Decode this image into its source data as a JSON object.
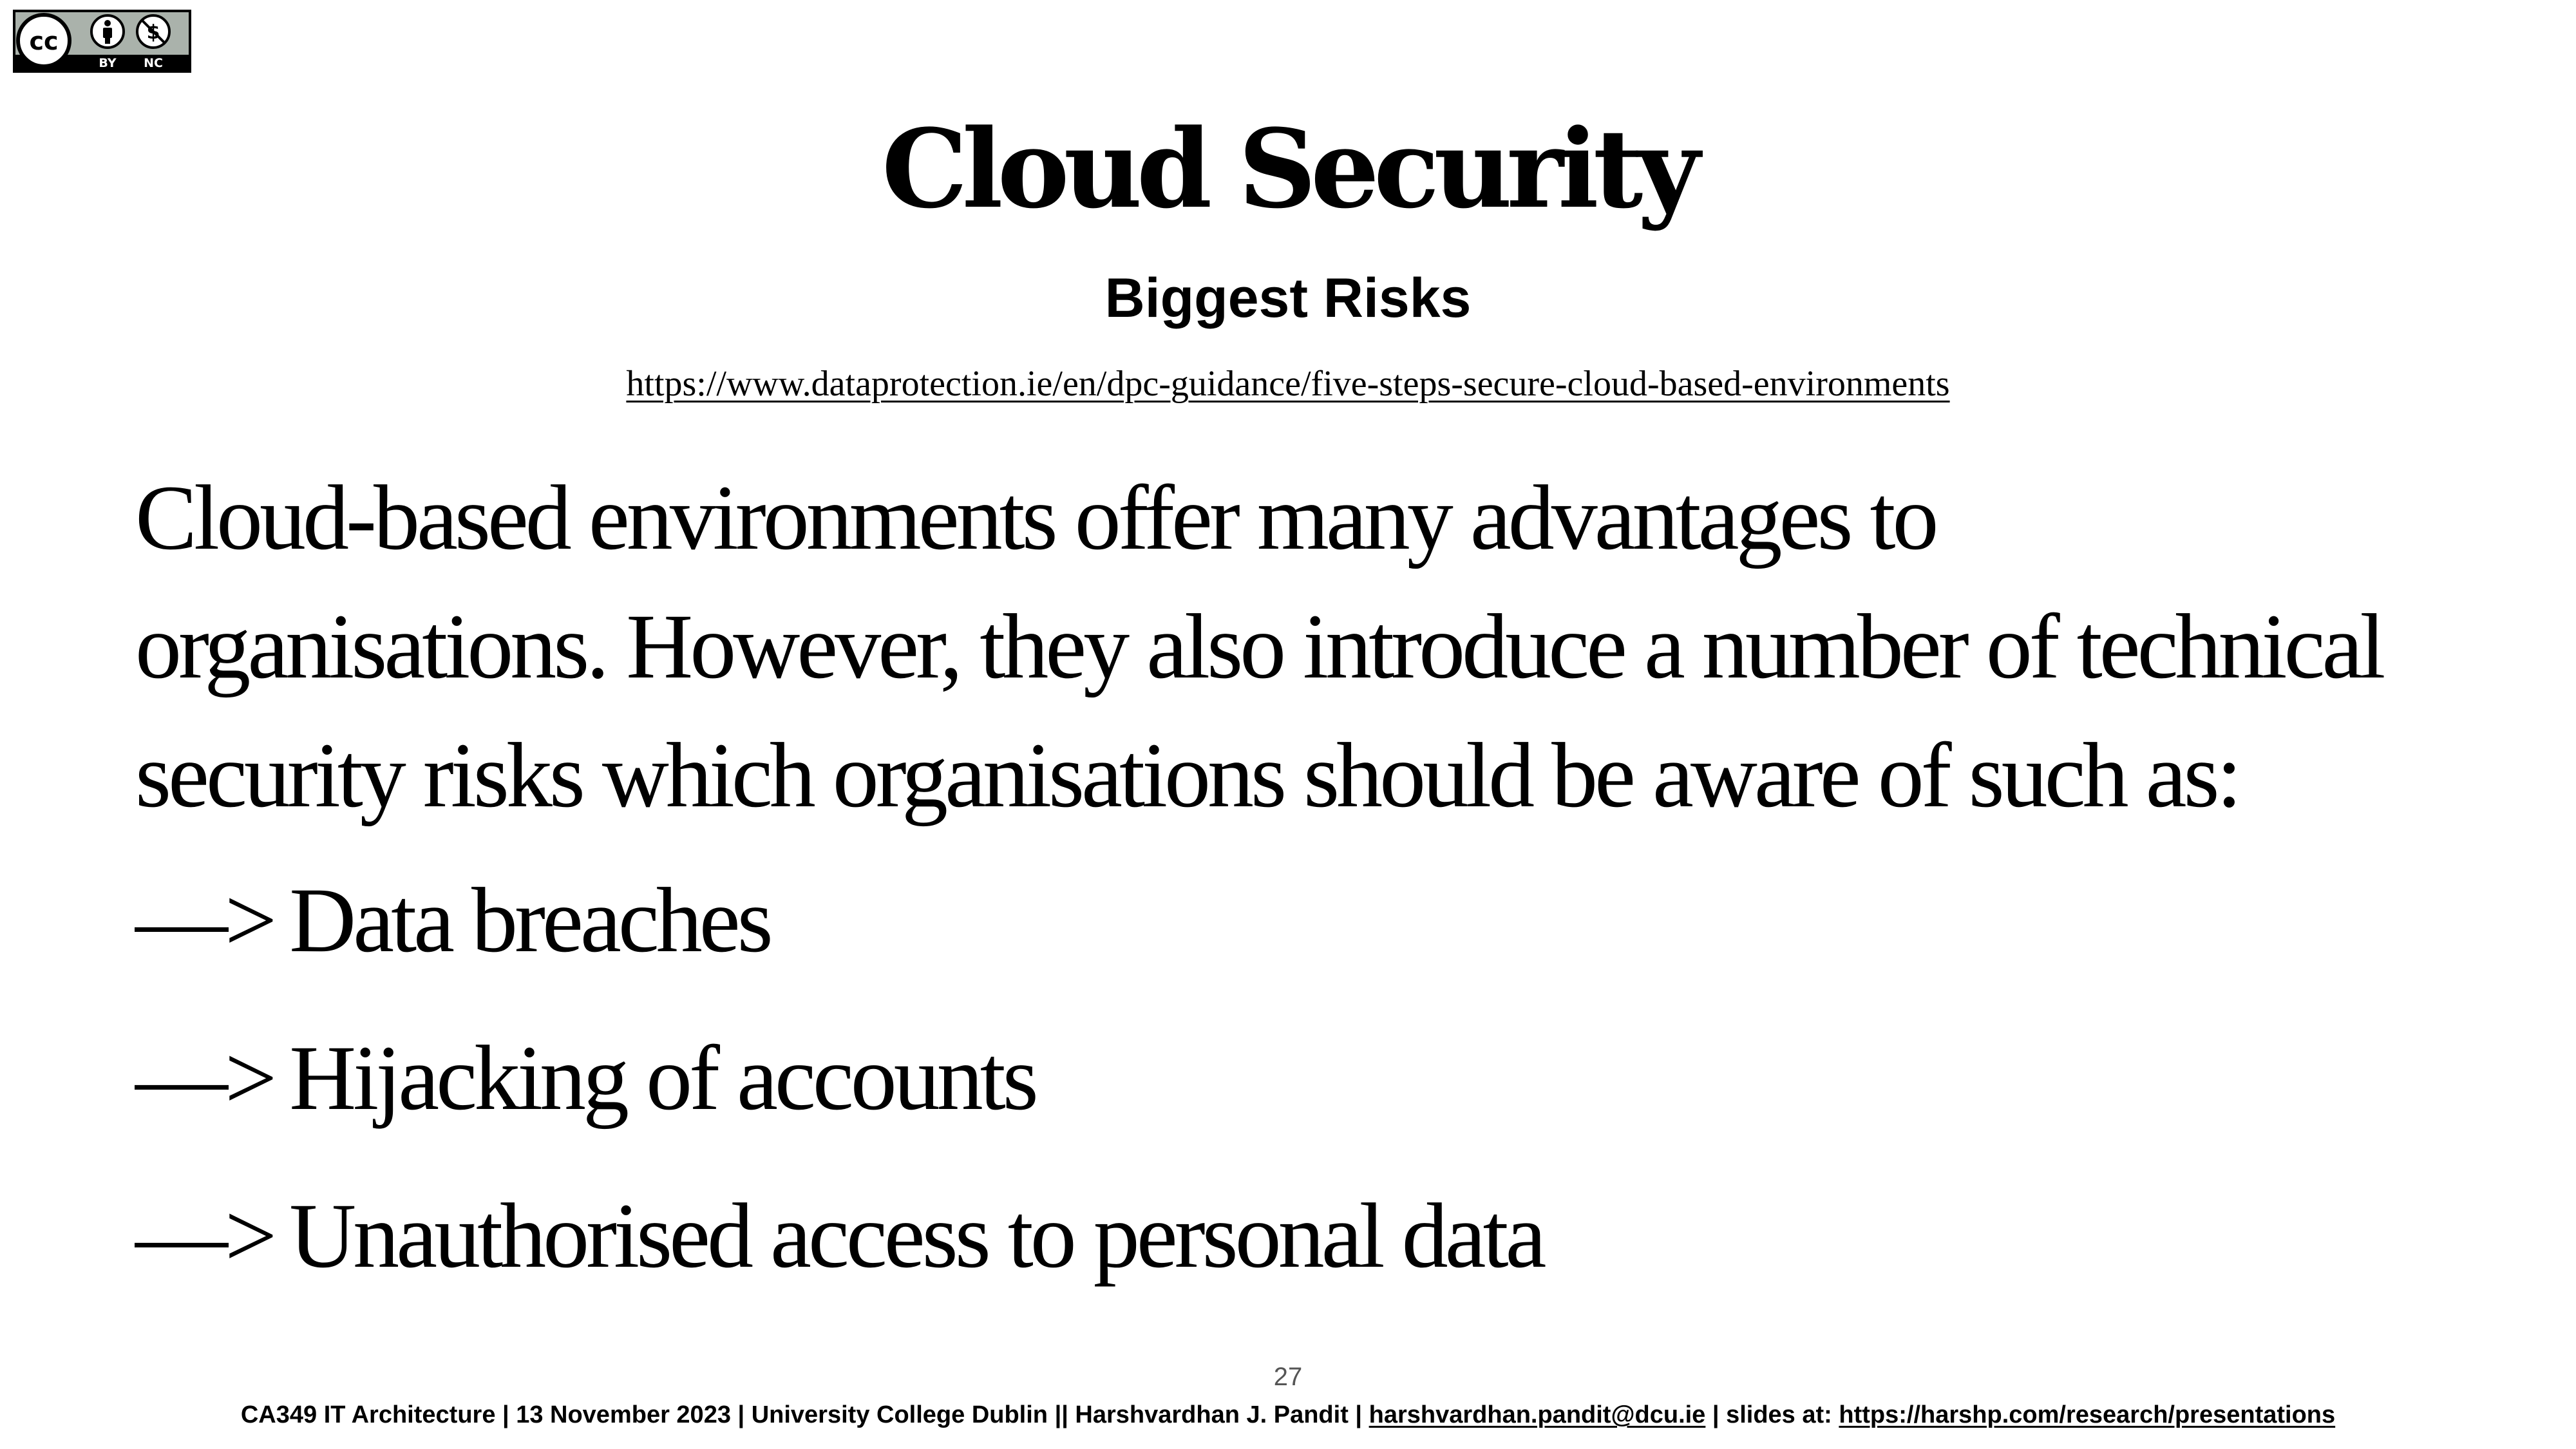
{
  "license_badge": {
    "icons": [
      "cc-icon",
      "attribution-icon",
      "noncommercial-icon"
    ],
    "labels": [
      "BY",
      "NC"
    ],
    "background_color": "#aab2ab"
  },
  "slide": {
    "title": "Cloud Security",
    "subtitle": "Biggest Risks",
    "source_url": "https://www.dataprotection.ie/en/dpc-guidance/five-steps-secure-cloud-based-environments",
    "intro_lines": [
      "Cloud-based environments offer many advantages to",
      "organisations. However, they also introduce a number of technical",
      "security risks which organisations should be aware of such as:"
    ],
    "risk_marker": "—>",
    "risks": [
      "Data breaches",
      "Hijacking of accounts",
      "Unauthorised access to personal data"
    ],
    "page_number": "27"
  },
  "footer": {
    "course_info": "CA349 IT Architecture | 13 November 2023 | University College Dublin  || Harshvardhan J. Pandit |",
    "email": "harshvardhan.pandit@dcu.ie",
    "slides_label": "| slides at:",
    "slides_url": "https://harshp.com/research/presentations"
  }
}
